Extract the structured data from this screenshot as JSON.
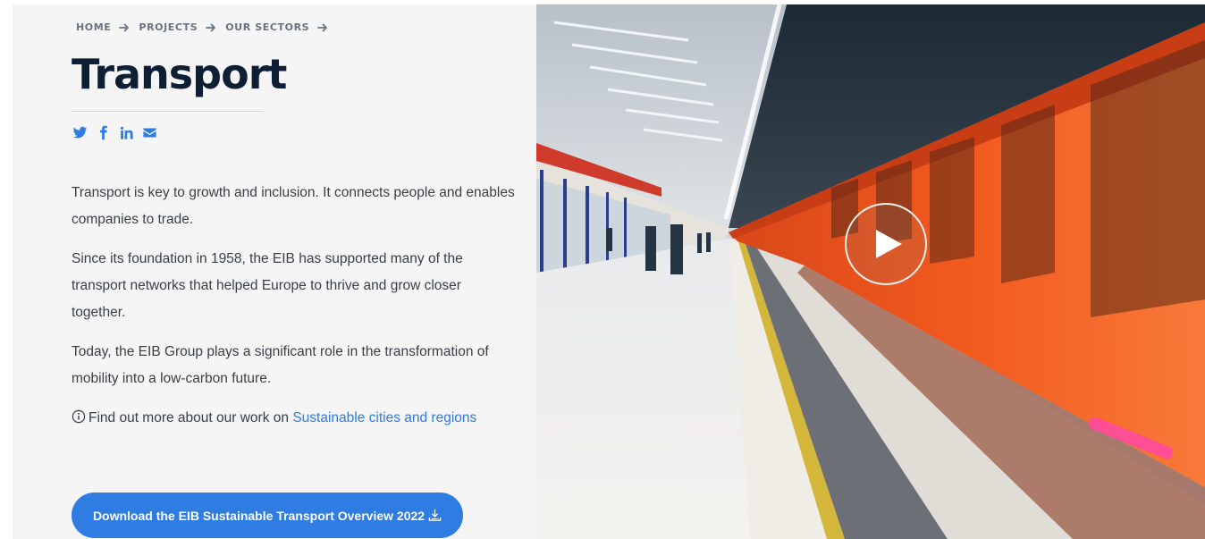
{
  "breadcrumb": {
    "items": [
      "HOME",
      "PROJECTS",
      "OUR SECTORS"
    ]
  },
  "page": {
    "title": "Transport"
  },
  "share": {
    "icons": [
      "twitter-icon",
      "facebook-icon",
      "linkedin-icon",
      "email-icon"
    ]
  },
  "intro": {
    "p1": "Transport is key to growth and inclusion. It connects people and enables companies to trade.",
    "p2": "Since its foundation in 1958, the EIB has supported many of the transport networks that helped Europe to thrive and grow closer together.",
    "p3": "Today, the EIB Group plays a significant role in the transformation of mobility into a low-carbon future.",
    "more_prefix": "Find out more about our work on",
    "more_link": "Sustainable cities and regions"
  },
  "download": {
    "label": "Download the EIB Sustainable Transport Overview 2022"
  },
  "hero": {
    "play_icon": "play-icon"
  },
  "colors": {
    "accent": "#2f7ce2",
    "title": "#0e1e35",
    "panel_bg": "#f5f5f5",
    "train": "#f25a1e"
  }
}
